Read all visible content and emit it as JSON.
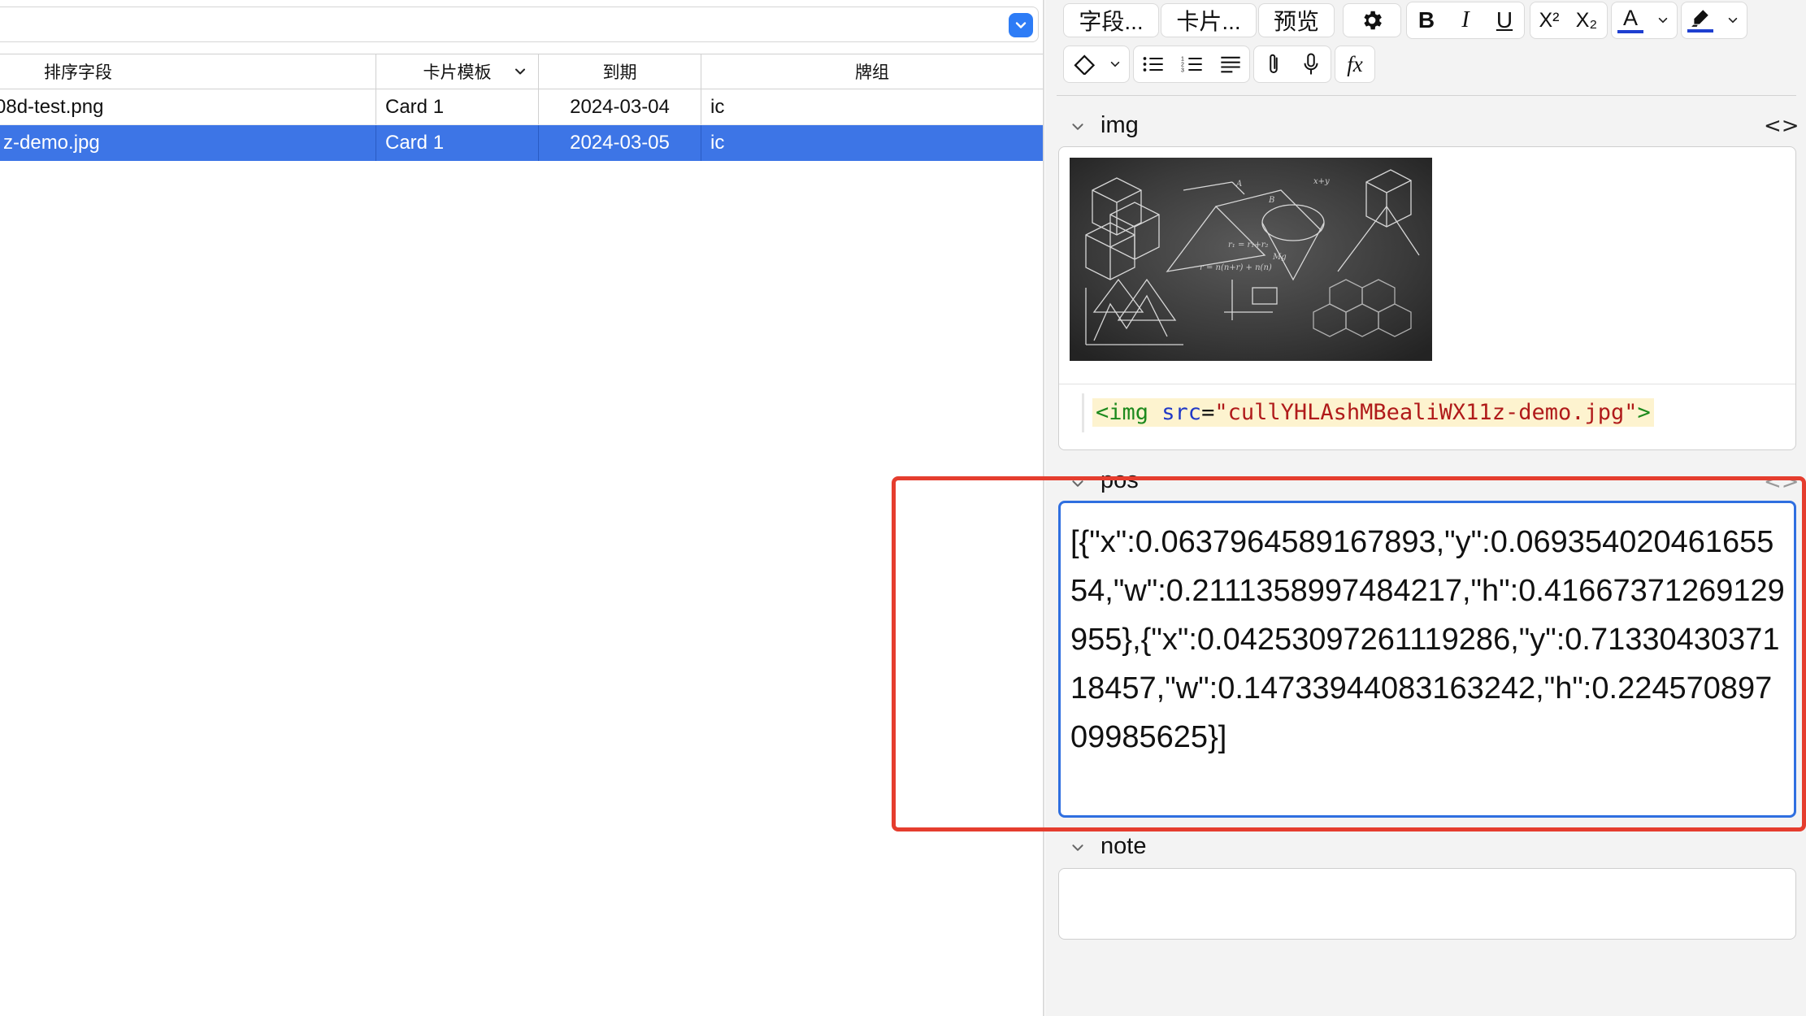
{
  "browser": {
    "columns": [
      {
        "label": "排序字段"
      },
      {
        "label": "卡片模板"
      },
      {
        "label": "到期"
      },
      {
        "label": "牌组"
      }
    ],
    "rows": [
      {
        "sort_field": "08d-test.png",
        "template": "Card 1",
        "due": "2024-03-04",
        "deck": "ic"
      },
      {
        "sort_field": "z-demo.jpg",
        "template": "Card 1",
        "due": "2024-03-05",
        "deck": "ic"
      }
    ]
  },
  "toolbar": {
    "fields_label": "字段...",
    "cards_label": "卡片...",
    "preview_label": "预览",
    "bold_label": "B",
    "italic_label": "I",
    "underline_label": "U",
    "superscript_label": "X²",
    "subscript_label": "X₂",
    "text_color_label": "A",
    "mathjax_label": "fx"
  },
  "fields": {
    "img": {
      "name": "img",
      "html_open": "<img ",
      "html_attr": "src",
      "html_eq": "=",
      "html_value": "\"cullYHLAshMBealiWX11z-demo.jpg\"",
      "html_close": ">"
    },
    "pos": {
      "name": "pos",
      "value": "[{\"x\":0.0637964589167893,\"y\":0.06935402046165554,\"w\":0.2111358997484217,\"h\":0.41667371269129955},{\"x\":0.04253097261119286,\"y\":0.7133043037118457,\"w\":0.14733944083163242,\"h\":0.22457089709985625}]"
    },
    "note": {
      "name": "note",
      "value": ""
    },
    "html_toggle": "<>"
  },
  "colors": {
    "selection": "#3d75e6",
    "focus_border": "#2f6fe0",
    "highlight": "#e53d2e",
    "text_color_swatch": "#1e3fd0"
  }
}
